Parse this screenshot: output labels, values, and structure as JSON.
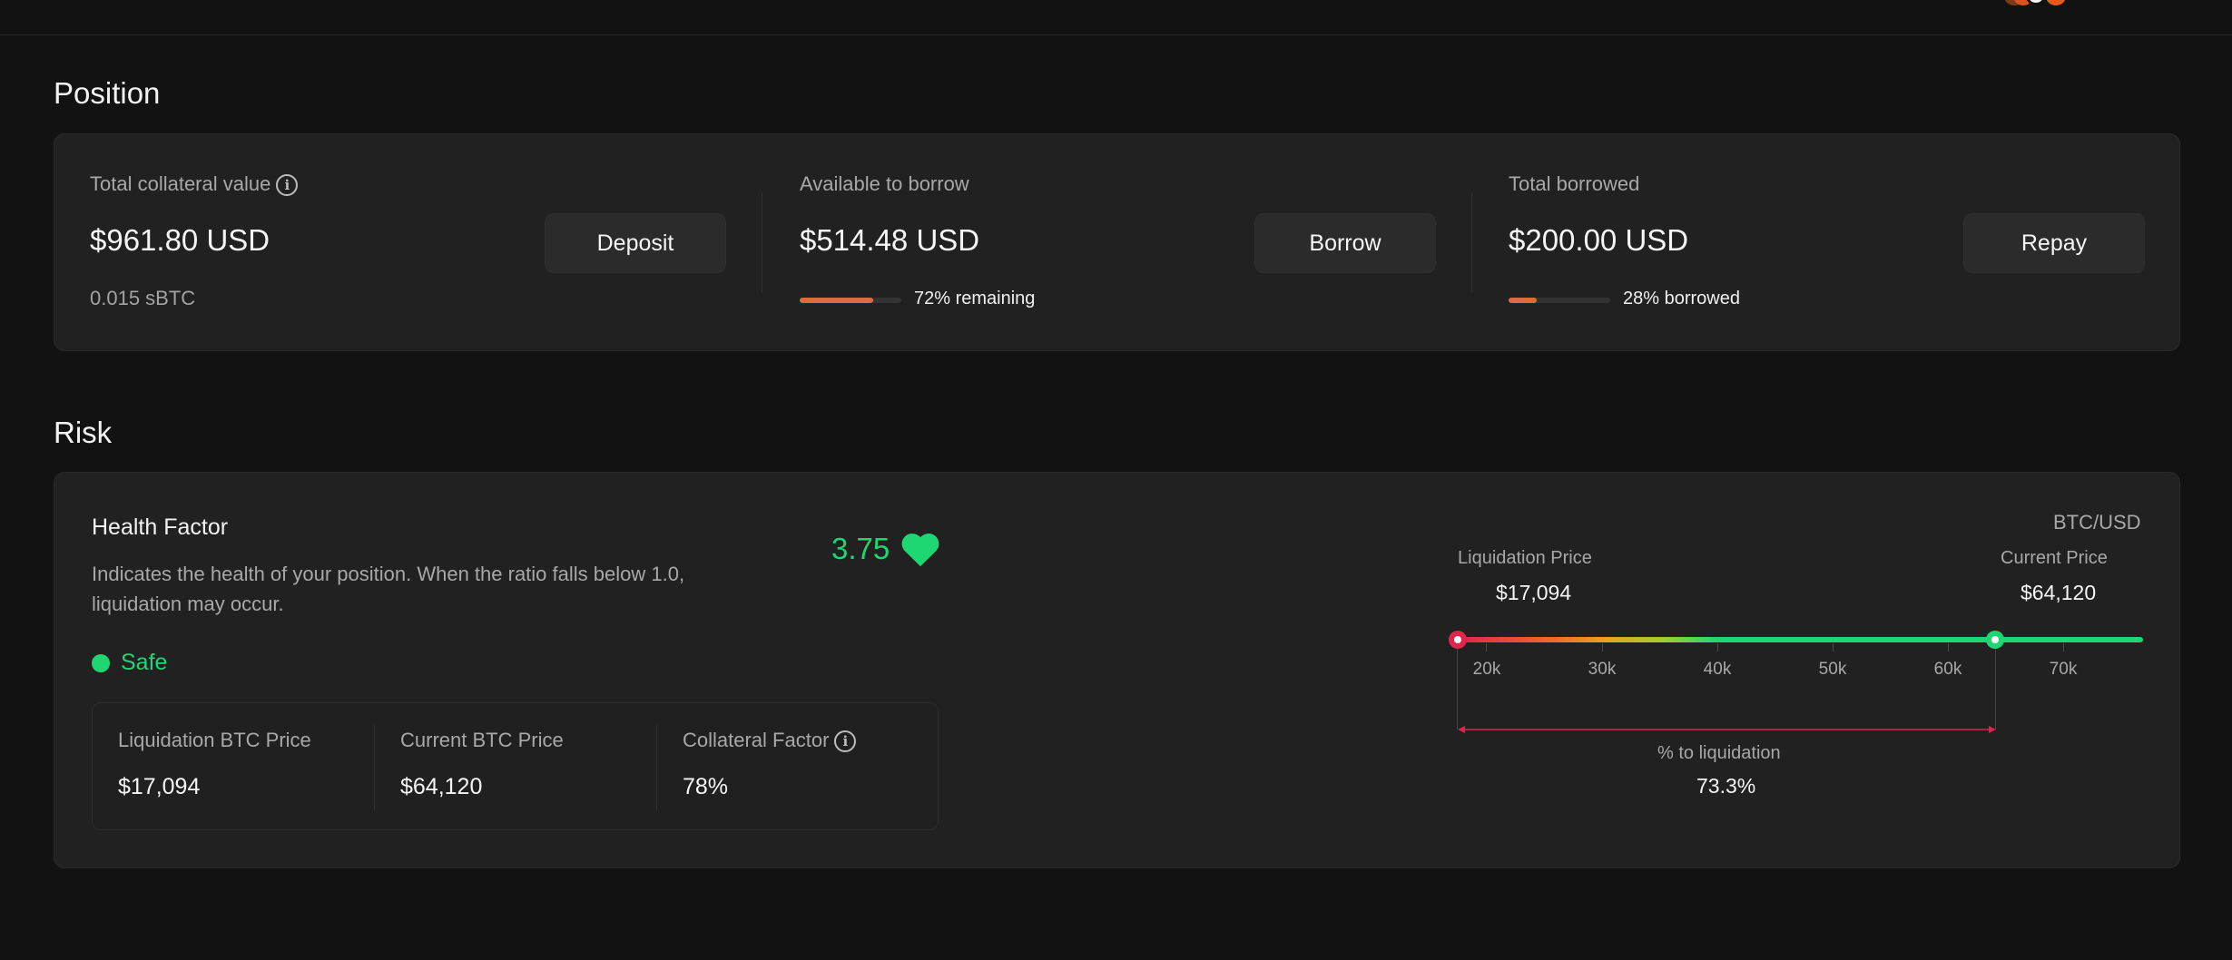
{
  "position": {
    "title": "Position",
    "collateral": {
      "label": "Total collateral value",
      "value": "$961.80 USD",
      "sub": "0.015 sBTC",
      "button": "Deposit"
    },
    "available": {
      "label": "Available to borrow",
      "value": "$514.48 USD",
      "progress_fraction": 0.72,
      "progress_text": "72% remaining",
      "button": "Borrow"
    },
    "borrowed": {
      "label": "Total borrowed",
      "value": "$200.00 USD",
      "progress_fraction": 0.28,
      "progress_text": "28% borrowed",
      "button": "Repay"
    }
  },
  "risk": {
    "title": "Risk",
    "health": {
      "title": "Health Factor",
      "description_line1": "Indicates the health of your position. When the ratio falls below 1.0,",
      "description_line2": "liquidation may occur.",
      "value": "3.75",
      "status": "Safe"
    },
    "stats": [
      {
        "label": "Liquidation BTC Price",
        "value": "$17,094"
      },
      {
        "label": "Current BTC Price",
        "value": "$64,120"
      },
      {
        "label": "Collateral Factor",
        "value": "78%"
      }
    ],
    "gauge": {
      "pair": "BTC/USD",
      "liquidation_label": "Liquidation Price",
      "liquidation_value": "$17,094",
      "current_label": "Current Price",
      "current_value": "$64,120",
      "ticks": [
        "20k",
        "30k",
        "40k",
        "50k",
        "60k",
        "70k"
      ],
      "distance_label": "% to liquidation",
      "distance_value": "73.3%"
    }
  },
  "colors": {
    "accent": "#e06a3b",
    "safe": "#1ed772",
    "danger": "#e0244a"
  }
}
